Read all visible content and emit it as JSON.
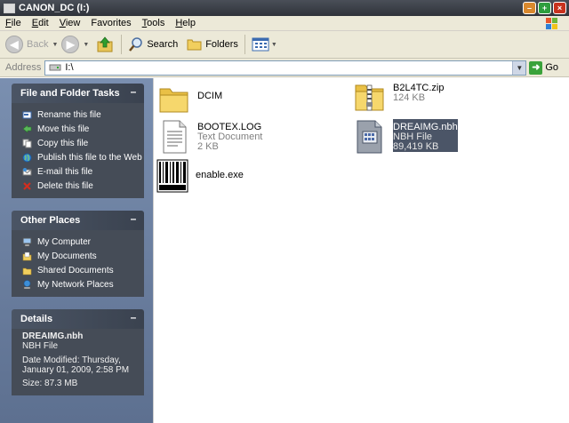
{
  "window": {
    "title": "CANON_DC (I:)"
  },
  "menu": [
    {
      "label": "File",
      "key": "F",
      "rest": "ile"
    },
    {
      "label": "Edit",
      "key": "E",
      "rest": "dit"
    },
    {
      "label": "View",
      "key": "V",
      "rest": "iew"
    },
    {
      "label": "Favorites",
      "key": "F",
      "rest": "avorites",
      "pre": ""
    },
    {
      "label": "Tools",
      "key": "T",
      "rest": "ools"
    },
    {
      "label": "Help",
      "key": "H",
      "rest": "elp"
    }
  ],
  "toolbar": {
    "back": "Back",
    "search": "Search",
    "folders": "Folders"
  },
  "address": {
    "label": "Address",
    "value": "I:\\",
    "go": "Go"
  },
  "tasks_panel": {
    "title": "File and Folder Tasks",
    "items": [
      "Rename this file",
      "Move this file",
      "Copy this file",
      "Publish this file to the Web",
      "E-mail this file",
      "Delete this file"
    ]
  },
  "places_panel": {
    "title": "Other Places",
    "items": [
      "My Computer",
      "My Documents",
      "Shared Documents",
      "My Network Places"
    ]
  },
  "details_panel": {
    "title": "Details",
    "name": "DREAIMG.nbh",
    "type": "NBH File",
    "modified_1": "Date Modified: Thursday,",
    "modified_2": "January 01, 2009, 2:58 PM",
    "size": "Size: 87.3 MB"
  },
  "files": [
    {
      "name": "DCIM",
      "line2": "",
      "line3": "",
      "icon": "folder-icon"
    },
    {
      "name": "B2L4TC.zip",
      "line2": "124 KB",
      "line3": "",
      "icon": "zip-folder-icon"
    },
    {
      "name": "BOOTEX.LOG",
      "line2": "Text Document",
      "line3": "2 KB",
      "icon": "text-document-icon"
    },
    {
      "name": "DREAIMG.nbh",
      "line2": "NBH File",
      "line3": "89,419 KB",
      "icon": "generic-file-icon"
    },
    {
      "name": "enable.exe",
      "line2": "",
      "line3": "",
      "icon": "barcode-exe-icon"
    }
  ],
  "colors": {
    "selection": "#4b5567",
    "sidebar": "#5d7090",
    "panel_body": "#454c57"
  }
}
